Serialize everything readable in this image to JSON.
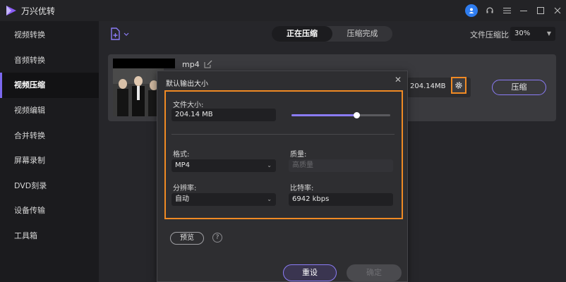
{
  "app": {
    "title": "万兴优转"
  },
  "titlebar": {
    "icons": [
      "user-icon",
      "headset-icon",
      "menu-icon",
      "minimize-icon",
      "maximize-icon",
      "close-icon"
    ]
  },
  "sidebar": {
    "items": [
      {
        "label": "视频转换",
        "active": false
      },
      {
        "label": "音频转换",
        "active": false
      },
      {
        "label": "视频压缩",
        "active": true
      },
      {
        "label": "视频编辑",
        "active": false
      },
      {
        "label": "合并转换",
        "active": false
      },
      {
        "label": "屏幕录制",
        "active": false
      },
      {
        "label": "DVD刻录",
        "active": false
      },
      {
        "label": "设备传输",
        "active": false
      },
      {
        "label": "工具箱",
        "active": false
      }
    ]
  },
  "toolbar": {
    "tabs": [
      {
        "label": "正在压缩",
        "active": true
      },
      {
        "label": "压缩完成",
        "active": false
      }
    ],
    "ratio_label": "文件压缩比",
    "ratio_value": "30%"
  },
  "file": {
    "ext": "mp4",
    "size": "204.14MB",
    "compress_label": "压缩"
  },
  "dialog": {
    "title": "默认输出大小",
    "file_size_label": "文件大小:",
    "file_size_value": "204.14 MB",
    "slider_fraction": 0.66,
    "format_label": "格式:",
    "format_value": "MP4",
    "quality_label": "质量:",
    "quality_value": "高质量",
    "resolution_label": "分辨率:",
    "resolution_value": "自动",
    "bitrate_label": "比特率:",
    "bitrate_value": "6942 kbps",
    "preview_label": "预览",
    "help_icon": "?",
    "reset_label": "重设",
    "ok_label": "确定"
  },
  "colors": {
    "accent": "#8b7cf6",
    "highlight": "#f08a24"
  }
}
